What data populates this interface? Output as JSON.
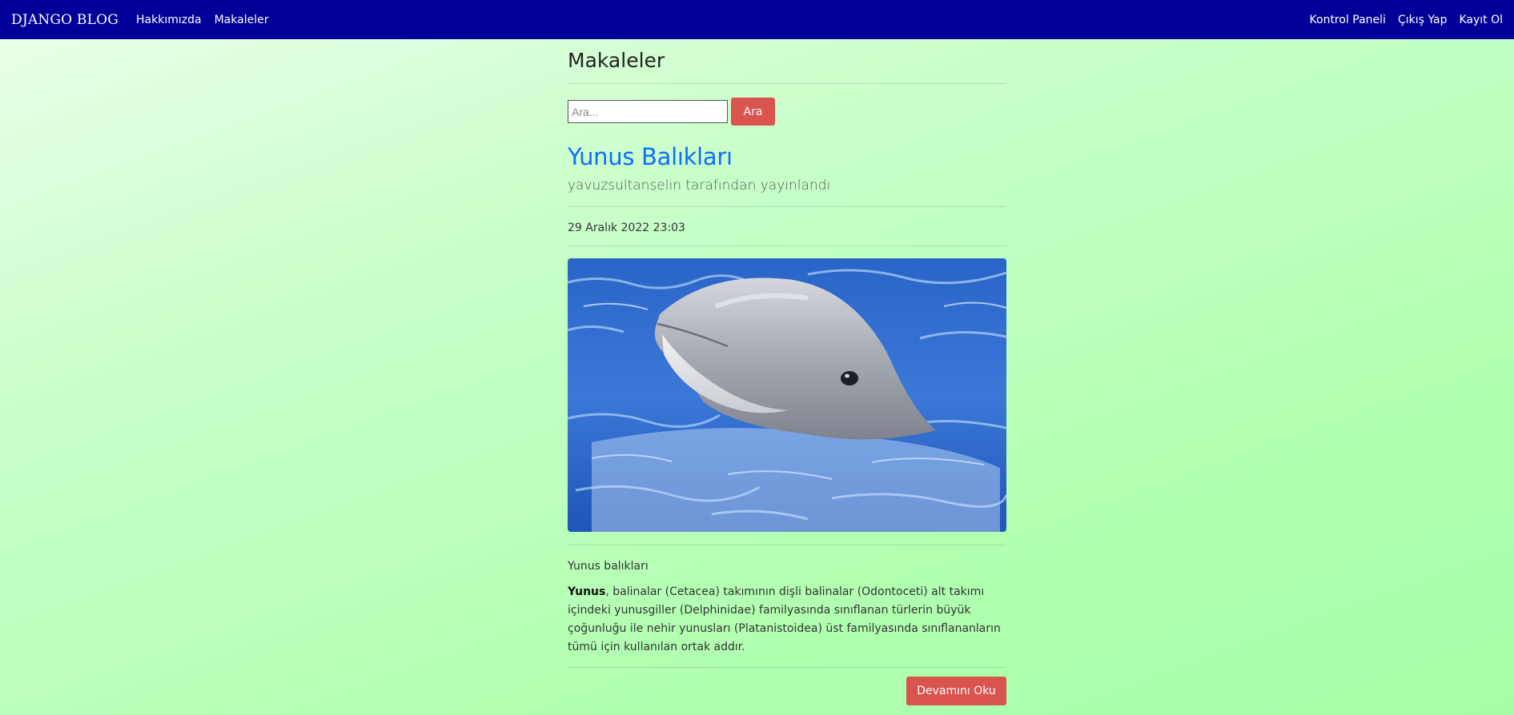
{
  "navbar": {
    "brand": "DJANGO BLOG",
    "left_links": [
      "Hakkımızda",
      "Makaleler"
    ],
    "right_links": [
      "Kontrol Paneli",
      "Çıkış Yap",
      "Kayıt Ol"
    ],
    "bg_color": "#000099"
  },
  "page": {
    "title": "Makaleler"
  },
  "search": {
    "placeholder": "Ara...",
    "value": "",
    "button_label": "Ara"
  },
  "article": {
    "title": "Yunus Balıkları",
    "author_line": "yavuzsultanselin tarafından yayınlandı",
    "date": "29 Aralık 2022 23:03",
    "image_icon": "dolphin-photo",
    "lead": "Yunus balıkları",
    "body_bold": "Yunus",
    "body_rest": ", balinalar (Cetacea) takımının dişli balinalar (Odontoceti) alt takımı içindeki yunusgiller (Delphinidae) familyasında sınıflanan türlerin büyük çoğunluğu ile nehir yunusları (Platanistoidea) üst familyasında sınıflananların tümü için kullanılan ortak addır.",
    "read_more_label": "Devamını Oku"
  },
  "colors": {
    "accent_red": "#d9534f",
    "link_blue": "#0d6efd"
  }
}
